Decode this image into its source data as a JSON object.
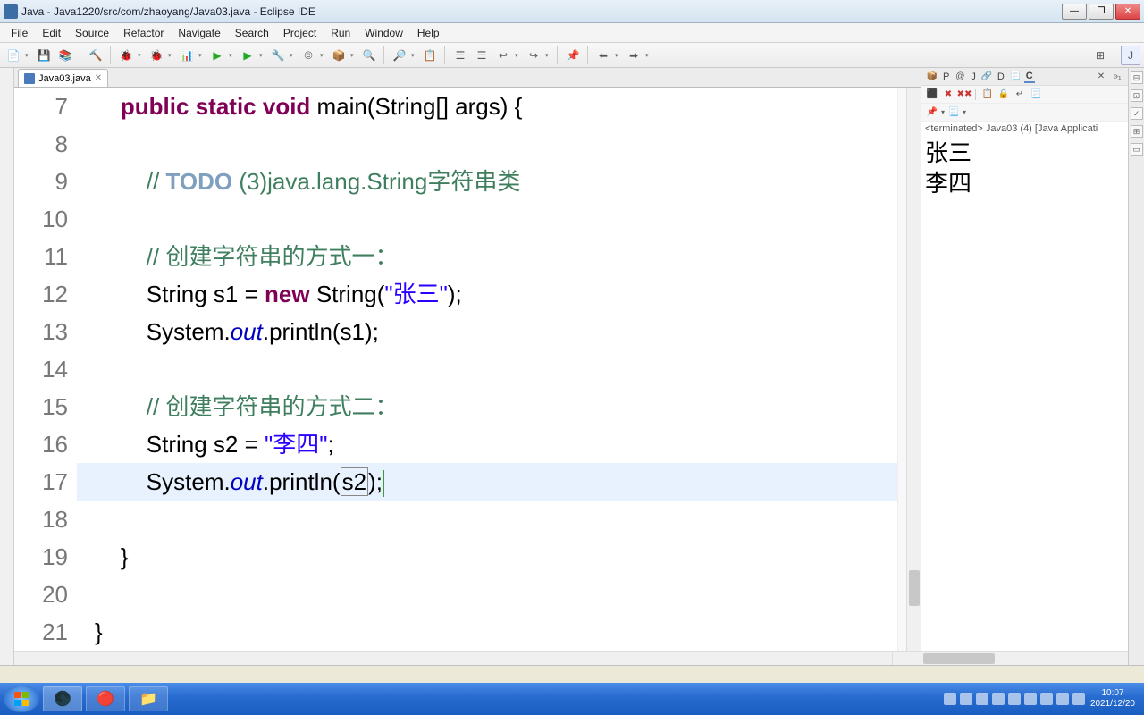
{
  "window": {
    "title": "Java - Java1220/src/com/zhaoyang/Java03.java - Eclipse IDE",
    "minimize": "—",
    "maximize": "❐",
    "close": "✕"
  },
  "menu": [
    "File",
    "Edit",
    "Source",
    "Refactor",
    "Navigate",
    "Search",
    "Project",
    "Run",
    "Window",
    "Help"
  ],
  "editor": {
    "tab_label": "Java03.java",
    "tab_close": "✕",
    "line_start": 7,
    "lines": [
      {
        "n": 7,
        "type": "code",
        "html": "    <span class='kw'>public</span> <span class='kw'>static</span> <span class='kw'>void</span> main(String[] args) {"
      },
      {
        "n": 8,
        "type": "blank",
        "html": ""
      },
      {
        "n": 9,
        "type": "code",
        "html": "        <span class='comment'>// </span><span class='todo'>TODO</span><span class='comment'> (3)java.lang.String字符串类</span>"
      },
      {
        "n": 10,
        "type": "blank",
        "html": ""
      },
      {
        "n": 11,
        "type": "code",
        "html": "        <span class='comment'>// 创建字符串的方式一：</span>"
      },
      {
        "n": 12,
        "type": "code",
        "html": "        String s1 = <span class='kw'>new</span> String(<span class='str'>\"张三\"</span>);"
      },
      {
        "n": 13,
        "type": "code",
        "html": "        System.<span class='field'>out</span>.println(s1);"
      },
      {
        "n": 14,
        "type": "blank",
        "html": ""
      },
      {
        "n": 15,
        "type": "code",
        "html": "        <span class='comment'>// 创建字符串的方式二：</span>"
      },
      {
        "n": 16,
        "type": "code",
        "html": "        String s2 = <span class='str'>\"李四\"</span>;"
      },
      {
        "n": 17,
        "type": "code",
        "hl": true,
        "html": "        System.<span class='field'>out</span>.println(<span class='boxed'>s2</span>);<span class='cursor'></span>"
      },
      {
        "n": 18,
        "type": "blank",
        "html": ""
      },
      {
        "n": 19,
        "type": "code",
        "html": "    }"
      },
      {
        "n": 20,
        "type": "blank",
        "html": ""
      },
      {
        "n": 21,
        "type": "code",
        "html": "}"
      }
    ]
  },
  "right": {
    "tabs": [
      {
        "icon": "📦",
        "label": "P"
      },
      {
        "icon": "@",
        "label": "J"
      },
      {
        "icon": "🔗",
        "label": "D"
      },
      {
        "icon": "📃",
        "label": "C",
        "active": true
      }
    ],
    "status": "<terminated> Java03 (4) [Java Applicati",
    "output": [
      "张三",
      "李四"
    ]
  },
  "taskbar": {
    "time": "10:07",
    "date": "2021/12/20"
  }
}
